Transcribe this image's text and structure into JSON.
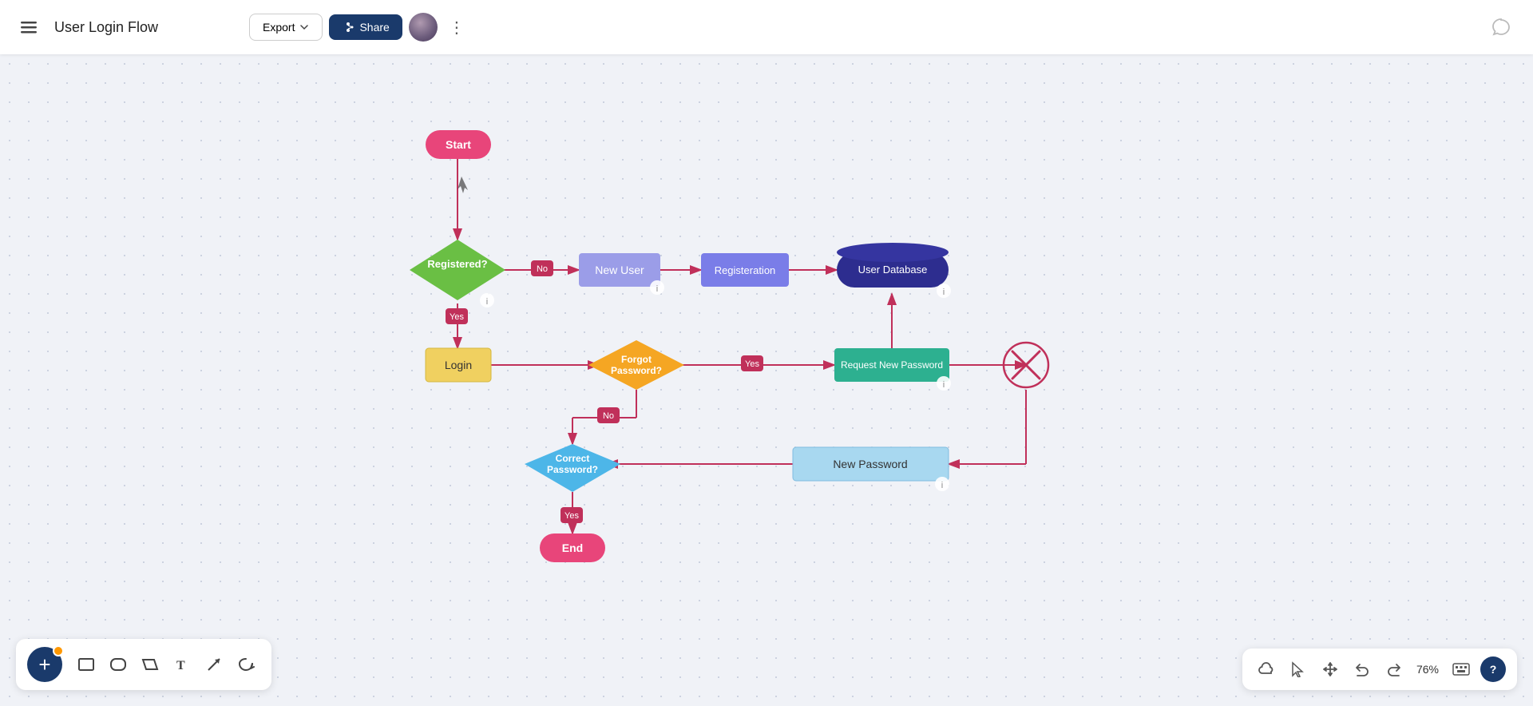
{
  "header": {
    "menu_label": "Menu",
    "title": "User Login Flow",
    "export_label": "Export",
    "share_label": "Share",
    "more_label": "More options"
  },
  "toolbar": {
    "add_label": "+",
    "tools": [
      "rectangle",
      "rounded-rectangle",
      "parallelogram",
      "text",
      "arrow",
      "lasso"
    ],
    "zoom_level": "76%",
    "zoom_in": "+",
    "zoom_out": "-",
    "undo": "Undo",
    "redo": "Redo"
  },
  "flowchart": {
    "nodes": [
      {
        "id": "start",
        "label": "Start",
        "type": "capsule",
        "color": "#e8457a"
      },
      {
        "id": "registered",
        "label": "Registered?",
        "type": "diamond",
        "color": "#6abf44"
      },
      {
        "id": "login",
        "label": "Login",
        "type": "rectangle",
        "color": "#f5d76e"
      },
      {
        "id": "new_user",
        "label": "New User",
        "type": "rectangle",
        "color": "#9b9de8"
      },
      {
        "id": "registration",
        "label": "Registeration",
        "type": "rectangle",
        "color": "#7a7de8"
      },
      {
        "id": "user_database",
        "label": "User Database",
        "type": "cylinder",
        "color": "#3a3a9a"
      },
      {
        "id": "forgot_password",
        "label": "Forgot Password?",
        "type": "diamond",
        "color": "#f5a623"
      },
      {
        "id": "request_new_password",
        "label": "Request New Password",
        "type": "rectangle",
        "color": "#2db090"
      },
      {
        "id": "correct_password",
        "label": "Correct Password?",
        "type": "diamond",
        "color": "#4db6e8"
      },
      {
        "id": "new_password",
        "label": "New Password",
        "type": "rectangle",
        "color": "#a8d8f0"
      },
      {
        "id": "end",
        "label": "End",
        "type": "capsule",
        "color": "#e8457a"
      },
      {
        "id": "x_circle",
        "label": "",
        "type": "x_circle",
        "color": "#e8457a"
      }
    ],
    "edges": {
      "labels": [
        "No",
        "Yes",
        "Yes",
        "No",
        "Yes"
      ]
    }
  }
}
